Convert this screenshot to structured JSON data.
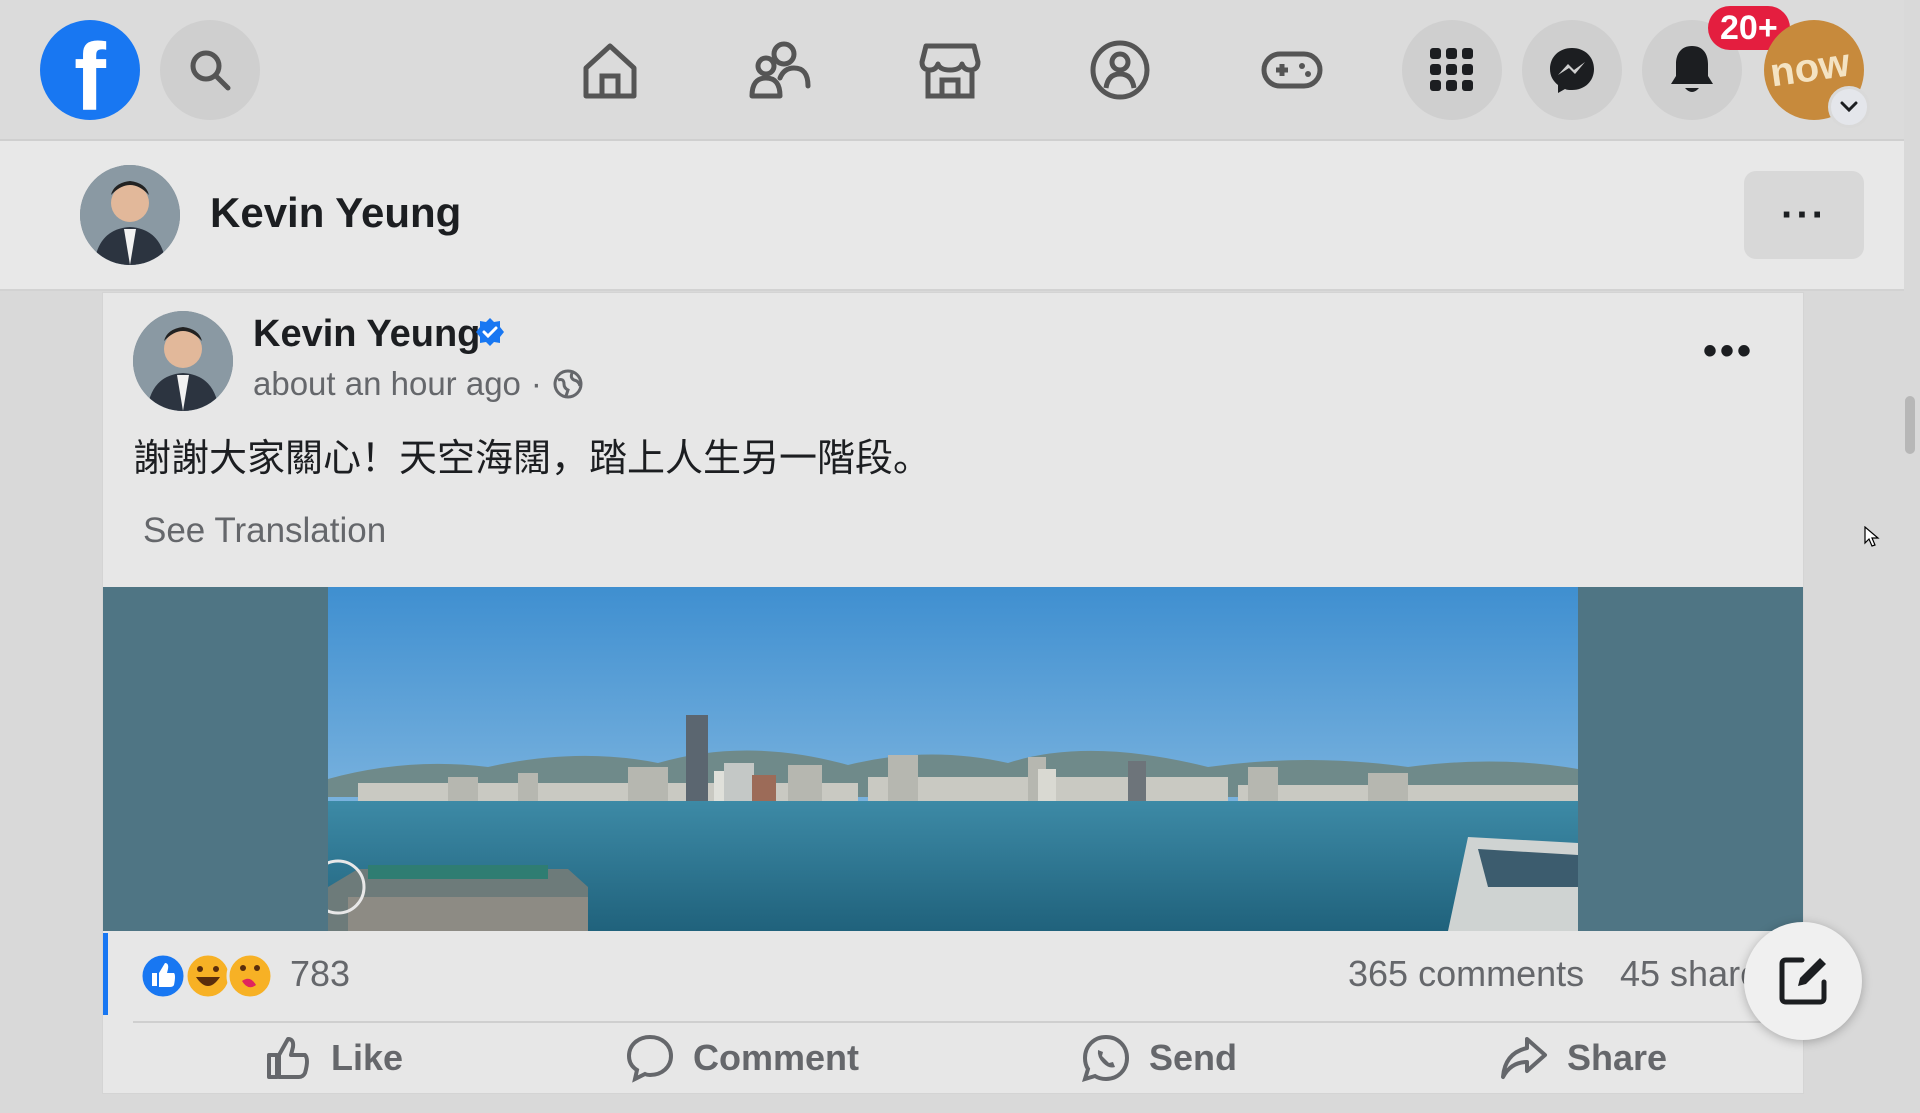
{
  "nav": {
    "notification_badge": "20+",
    "account_avatar_text": "now",
    "icons": [
      "facebook-logo",
      "search-icon",
      "home-icon",
      "friends-icon",
      "marketplace-icon",
      "groups-icon",
      "gaming-icon",
      "menu-grid-icon",
      "messenger-icon",
      "bell-icon",
      "chevron-down-icon"
    ]
  },
  "profile_header": {
    "name": "Kevin Yeung",
    "more_label": "···"
  },
  "post": {
    "author": "Kevin Yeung",
    "timestamp": "about an hour ago",
    "separator": "·",
    "body": "謝謝大家關心！天空海闊，踏上人生另一階段。",
    "see_translation": "See Translation",
    "reaction_count": "783",
    "comments": "365 comments",
    "shares": "45 shares",
    "actions": {
      "like": "Like",
      "comment": "Comment",
      "send": "Send",
      "share": "Share"
    }
  },
  "colors": {
    "brand_blue": "#1877f2",
    "badge_red": "#e41e3f",
    "muted_text": "#65676b"
  }
}
